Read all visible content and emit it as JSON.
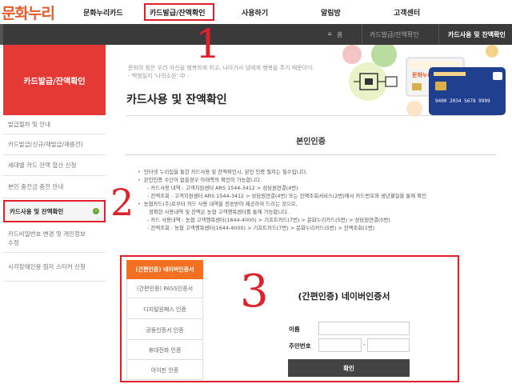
{
  "header": {
    "logo_text": "문화누리",
    "nav": [
      "문화누리카드",
      "카드발급/잔액확인",
      "사용하기",
      "알림방",
      "고객센터"
    ]
  },
  "breadcrumb": {
    "home_icon": "home-icon",
    "home": "홈",
    "items": [
      "카드발급/잔액확인",
      "카드사용 및 잔액확인"
    ]
  },
  "sidebar": {
    "title": "카드발급/잔액확인",
    "items": [
      {
        "label": "발급절차 및 안내"
      },
      {
        "label": "카드발급(신규/재발급/재충전)"
      },
      {
        "label": "세대별 카드 잔액 합산 신청"
      },
      {
        "label": "본인 충전금 충전 안내"
      },
      {
        "label": "카드사용 및 잔액확인",
        "active": true
      },
      {
        "label": "카드비밀번호 변경 및 개인정보수정"
      },
      {
        "label": "시각장애인용 점자 스티커 신청"
      }
    ]
  },
  "annotations": [
    "1",
    "2",
    "3"
  ],
  "main": {
    "quote_line1": "문화의 힘은 우리 자신을 행복하게 하고, 나아가서 남에게 행복을 주기 때문이다.",
    "quote_line2": "- 백범일지 '나의소원' 中 -",
    "title": "카드사용 및 잔액확인",
    "card_number": "9400 2034 5678 9999",
    "section_title": "본인인증",
    "info": [
      {
        "text": "인터넷 누리집을 통한 카드사용 및 잔액확인시, 본인 인증 절차는 필수입니다.",
        "type": "bullet"
      },
      {
        "text": "본인인증 수단이 없을경우 아래쪽의 확인이 가능합니다.",
        "type": "bullet"
      },
      {
        "text": "- 카드사용 내역 : 고객지원센터 ARS 1544-3412 > 상담원연결(4번)",
        "type": "indent"
      },
      {
        "text": "- 잔액조회 : 고객지원센터 ARS 1544-3412 > 상담원연결(4번) 또는 잔액조회서비스(2번)에서 카드번호와 생년월일을 통해 확인",
        "type": "indent"
      },
      {
        "text": "농협카드(주)로부터 카드 사용 내역을 전송받아 제공하여 드리는 것으로,",
        "type": "bullet"
      },
      {
        "text": "정확한 사용내역 및 잔액은 농협 고객행복센터를 통해 가능합니다.",
        "type": "indent2"
      },
      {
        "text": "- 카드 사용내역 : 농협 고객행복센터(1644-4000) > 기프트카드(7번) > 문화누리카드(5번) > 상담원연결(0번)",
        "type": "indent"
      },
      {
        "text": "- 잔액조회 : 농협 고객행복센터(1644-4000) > 기프트카드(7번) > 문화누리카드(5번) > 잔액조회(1번)",
        "type": "indent"
      }
    ]
  },
  "auth": {
    "tabs": [
      {
        "label": "(간편인증) 네이버인증서",
        "active": true
      },
      {
        "label": "(간편인증) PASS인증서"
      },
      {
        "label": "디지털원패스 인증"
      },
      {
        "label": "공동인증서 인증"
      },
      {
        "label": "휴대전화 인증"
      },
      {
        "label": "아이핀 인증"
      }
    ],
    "form_title": "(간편인증) 네이버인증서",
    "name_label": "이름",
    "rrn_label": "주민번호",
    "dash": "-",
    "confirm_label": "확인"
  },
  "colors": {
    "accent_red": "#e53935",
    "tab_orange": "#f36f21",
    "annotation_red": "#e0202a",
    "dark_bar": "#3a3a3a"
  }
}
